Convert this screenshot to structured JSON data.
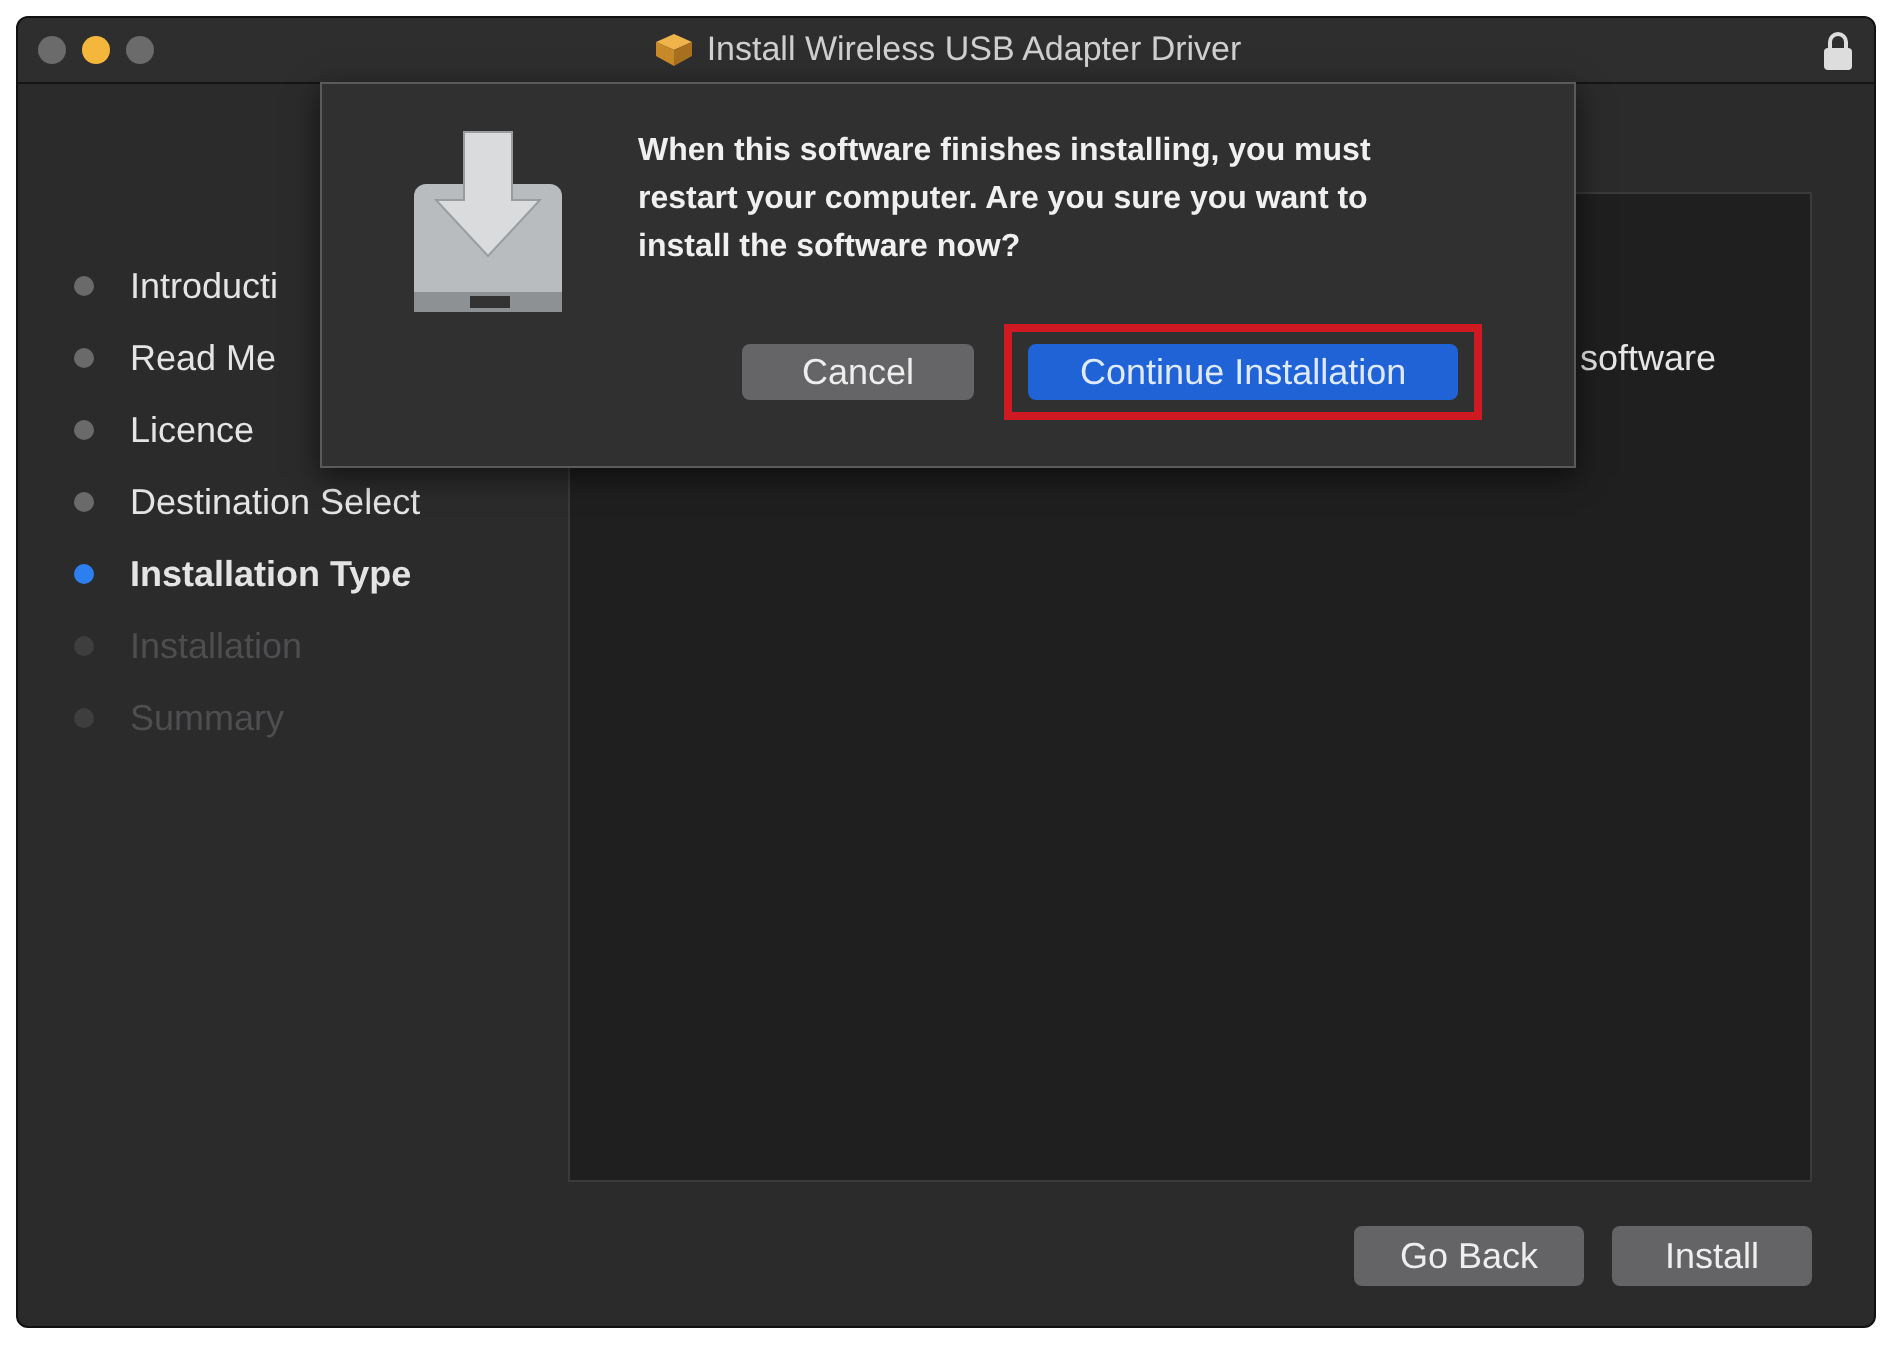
{
  "window": {
    "title": "Install Wireless USB Adapter Driver"
  },
  "steps": [
    {
      "label": "Introducti",
      "selected": false,
      "disabled": false
    },
    {
      "label": "Read Me",
      "selected": false,
      "disabled": false
    },
    {
      "label": "Licence",
      "selected": false,
      "disabled": false
    },
    {
      "label": "Destination Select",
      "selected": false,
      "disabled": false
    },
    {
      "label": "Installation Type",
      "selected": true,
      "disabled": false
    },
    {
      "label": "Installation",
      "selected": false,
      "disabled": true
    },
    {
      "label": "Summary",
      "selected": false,
      "disabled": true
    }
  ],
  "content": {
    "text": "software"
  },
  "dialog": {
    "message": "When this software finishes installing, you must restart your computer. Are you sure you want to install the software now?",
    "buttons": [
      {
        "label": "Cancel",
        "kind": "secondary",
        "highlighted": false
      },
      {
        "label": "Continue Installation",
        "kind": "primary",
        "highlighted": true
      }
    ]
  },
  "buttons": [
    {
      "label": "Go Back"
    },
    {
      "label": "Install"
    }
  ]
}
